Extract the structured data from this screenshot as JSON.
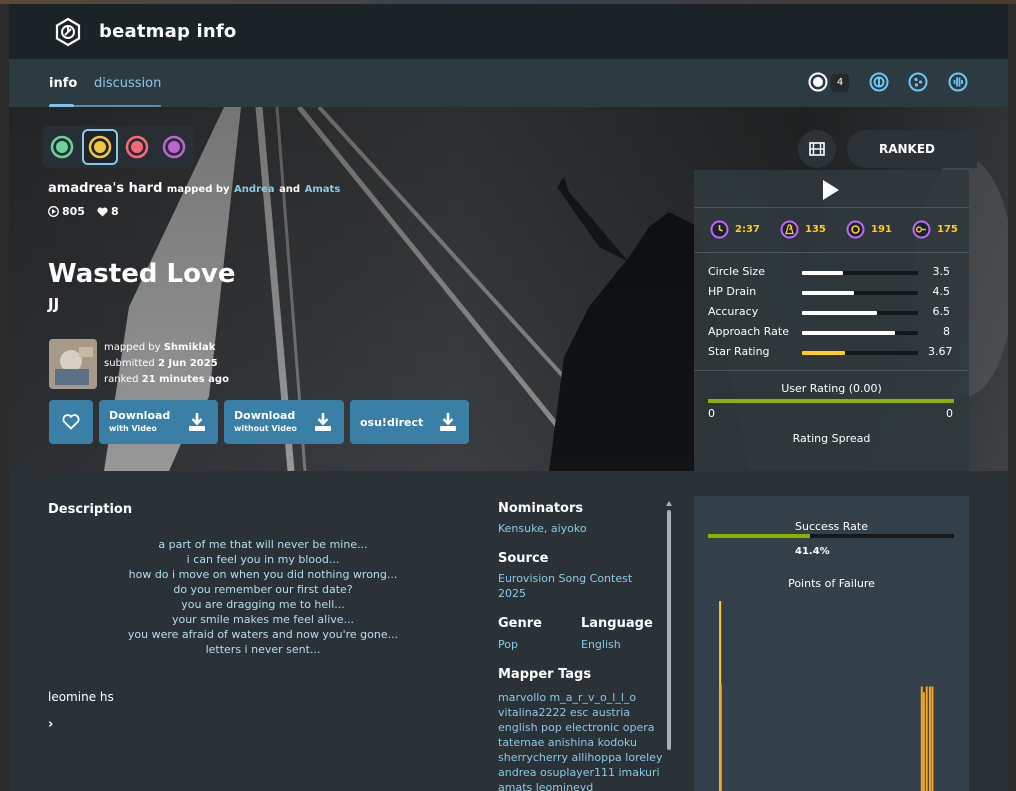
{
  "header": {
    "title": "beatmap info",
    "logo_icon": "beatmap-logo-icon"
  },
  "tabs": [
    {
      "label": "info",
      "active": true
    },
    {
      "label": "discussion",
      "active": false
    }
  ],
  "modes": {
    "selected_count": "4",
    "icons": [
      "osu-mode-icon",
      "taiko-mode-icon",
      "catch-mode-icon",
      "mania-mode-icon"
    ]
  },
  "difficulties": {
    "colors": [
      "#6ad49a",
      "#f5c542",
      "#ff6677",
      "#c061d4"
    ],
    "selected_index": 1
  },
  "beatmap": {
    "difficulty_name": "amadrea's hard",
    "mapped_by_label": "mapped by",
    "mappers": [
      "Andrea",
      "Amats"
    ],
    "and_label": "and",
    "play_count": "805",
    "favourite_count": "8",
    "title": "Wasted Love",
    "artist": "JJ",
    "creator_prefix": "mapped by",
    "creator": "Shmiklak",
    "submitted_prefix": "submitted",
    "submitted_date": "2 Jun 2025",
    "ranked_prefix": "ranked",
    "ranked_date": "21 minutes ago"
  },
  "buttons": {
    "download_video": {
      "label": "Download",
      "sub": "with Video"
    },
    "download_novideo": {
      "label": "Download",
      "sub": "without Video"
    },
    "direct": {
      "label": "osu!direct"
    }
  },
  "status": {
    "label": "RANKED"
  },
  "length_stats": [
    {
      "name": "length",
      "value": "2:37"
    },
    {
      "name": "bpm",
      "value": "135"
    },
    {
      "name": "circles",
      "value": "191"
    },
    {
      "name": "sliders",
      "value": "175"
    }
  ],
  "attributes": [
    {
      "label": "Circle Size",
      "value": "3.5",
      "fraction": 0.35,
      "color": "#ffffff"
    },
    {
      "label": "HP Drain",
      "value": "4.5",
      "fraction": 0.45,
      "color": "#ffffff"
    },
    {
      "label": "Accuracy",
      "value": "6.5",
      "fraction": 0.65,
      "color": "#ffffff"
    },
    {
      "label": "Approach Rate",
      "value": "8",
      "fraction": 0.8,
      "color": "#ffffff"
    },
    {
      "label": "Star Rating",
      "value": "3.67",
      "fraction": 0.367,
      "color": "#ffcc22"
    }
  ],
  "user_rating": {
    "label": "User Rating (0.00)",
    "min": "0",
    "max": "0",
    "spread_label": "Rating Spread"
  },
  "description": {
    "heading": "Description",
    "lines": [
      "a part of me that will never be mine...",
      "i can feel you in my blood...",
      "how do i move on when you did nothing wrong...",
      "do you remember our first date?",
      "you are dragging me to hell...",
      "your smile makes me feel alive...",
      "you were afraid of waters and now you're gone...",
      "letters i never sent..."
    ],
    "footer": "leomine hs",
    "chevron": "›"
  },
  "meta": {
    "nominators_label": "Nominators",
    "nominators": "Kensuke, aiyoko",
    "source_label": "Source",
    "source": "Eurovision Song Contest 2025",
    "genre_label": "Genre",
    "genre": "Pop",
    "language_label": "Language",
    "language": "English",
    "tags_label": "Mapper Tags",
    "tags": "marvollo m_a_r_v_o_l_l_o vitalina2222 esc austria english pop electronic opera tatemae anishina kodoku sherrycherry allihoppa loreley andrea osuplayer111 imakuri amats leomineyd"
  },
  "success": {
    "label": "Success Rate",
    "rate": 0.414,
    "rate_text": "41.4%",
    "failure_label": "Points of Failure",
    "failure_points": [
      {
        "x": 0.045,
        "h": 1.0
      },
      {
        "x": 0.048,
        "h": 0.56
      },
      {
        "x": 0.865,
        "h": 0.55
      },
      {
        "x": 0.873,
        "h": 0.52
      },
      {
        "x": 0.885,
        "h": 0.55
      },
      {
        "x": 0.898,
        "h": 0.55
      },
      {
        "x": 0.908,
        "h": 0.55
      }
    ]
  }
}
